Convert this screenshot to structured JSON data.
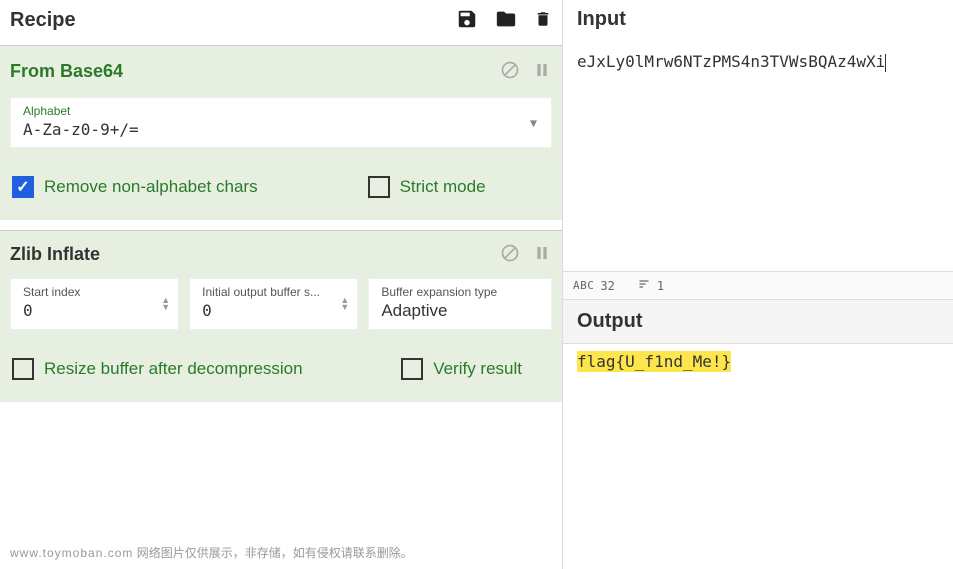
{
  "recipe": {
    "title": "Recipe",
    "ops": [
      {
        "name": "From Base64",
        "alphabet_label": "Alphabet",
        "alphabet_value": "A-Za-z0-9+/=",
        "remove_chars_label": "Remove non-alphabet chars",
        "remove_chars_checked": true,
        "strict_label": "Strict mode",
        "strict_checked": false
      },
      {
        "name": "Zlib Inflate",
        "start_index_label": "Start index",
        "start_index_value": "0",
        "initial_buffer_label": "Initial output buffer s...",
        "initial_buffer_value": "0",
        "buffer_expansion_label": "Buffer expansion type",
        "buffer_expansion_value": "Adaptive",
        "resize_label": "Resize buffer after decompression",
        "resize_checked": false,
        "verify_label": "Verify result",
        "verify_checked": false
      }
    ]
  },
  "input": {
    "title": "Input",
    "value": "eJxLy0lMrw6NTzPMS4n3TVWsBQAz4wXi"
  },
  "status": {
    "char_label": "ABC",
    "char_count": "32",
    "line_count": "1"
  },
  "output": {
    "title": "Output",
    "value": "flag{U_f1nd_Me!}"
  },
  "watermark": {
    "domain": "www.toymoban.com",
    "text": "网络图片仅供展示，非存储，如有侵权请联系删除。"
  }
}
